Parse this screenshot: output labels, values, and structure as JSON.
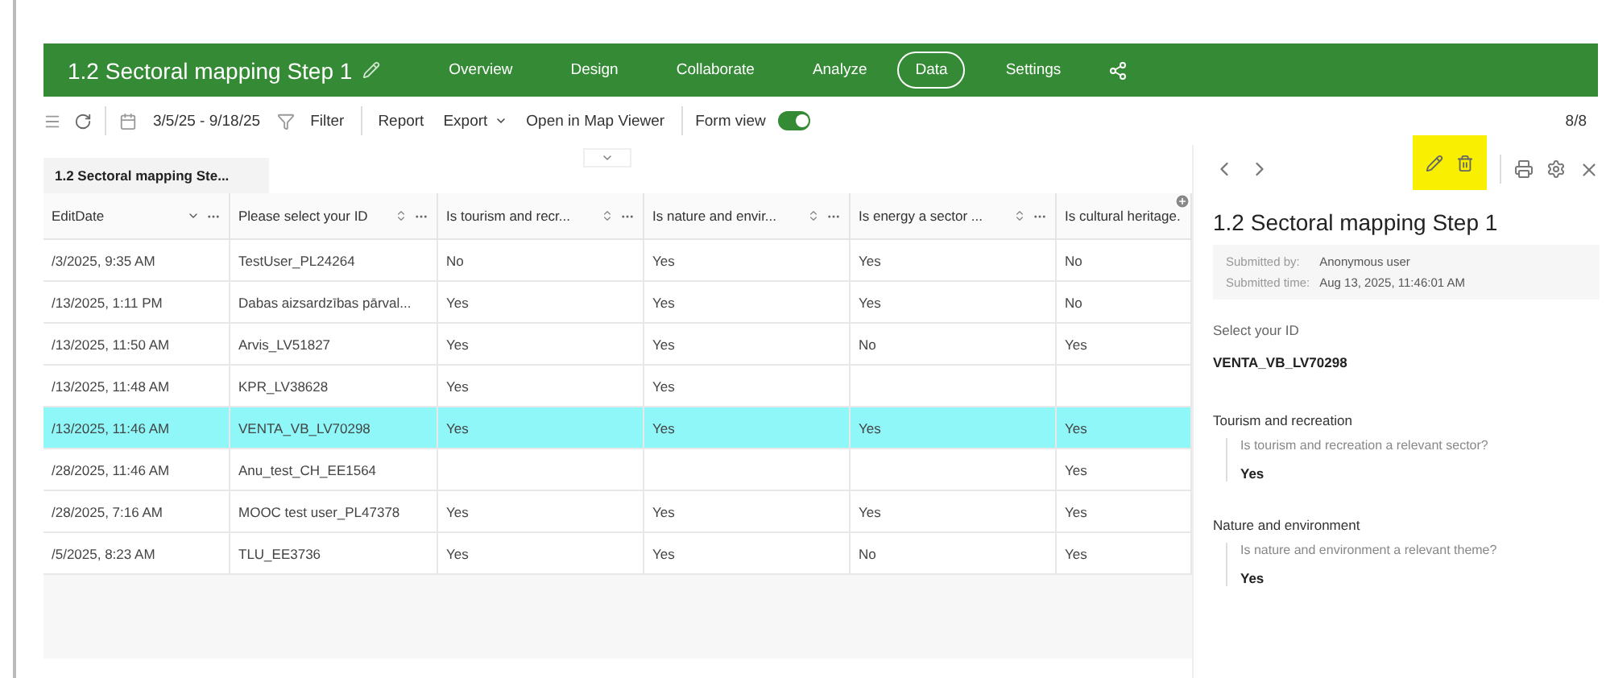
{
  "header": {
    "title": "1.2 Sectoral mapping Step 1",
    "nav": [
      {
        "label": "Overview",
        "selected": false
      },
      {
        "label": "Design",
        "selected": false
      },
      {
        "label": "Collaborate",
        "selected": false
      },
      {
        "label": "Analyze",
        "selected": false
      },
      {
        "label": "Data",
        "selected": true
      },
      {
        "label": "Settings",
        "selected": false
      }
    ]
  },
  "toolbar": {
    "date_range": "3/5/25 - 9/18/25",
    "filter": "Filter",
    "report": "Report",
    "export": "Export",
    "open_map": "Open in Map Viewer",
    "form_view": {
      "label": "Form view",
      "on": true
    },
    "count": "8/8"
  },
  "layer_tab": "1.2 Sectoral mapping Ste...",
  "table": {
    "columns": [
      "EditDate",
      "Please select your ID",
      "Is tourism and recr...",
      "Is nature and envir...",
      "Is energy a sector ...",
      "Is cultural heritage."
    ],
    "rows": [
      {
        "cells": [
          "/3/2025, 9:35 AM",
          "TestUser_PL24264",
          "No",
          "Yes",
          "Yes",
          "No"
        ],
        "selected": false
      },
      {
        "cells": [
          "/13/2025, 1:11 PM",
          "Dabas aizsardzības pārval...",
          "Yes",
          "Yes",
          "Yes",
          "No"
        ],
        "selected": false
      },
      {
        "cells": [
          "/13/2025, 11:50 AM",
          "Arvis_LV51827",
          "Yes",
          "Yes",
          "No",
          "Yes"
        ],
        "selected": false
      },
      {
        "cells": [
          "/13/2025, 11:48 AM",
          "KPR_LV38628",
          "Yes",
          "Yes",
          "",
          ""
        ],
        "selected": false
      },
      {
        "cells": [
          "/13/2025, 11:46 AM",
          "VENTA_VB_LV70298",
          "Yes",
          "Yes",
          "Yes",
          "Yes"
        ],
        "selected": true
      },
      {
        "cells": [
          "/28/2025, 11:46 AM",
          "Anu_test_CH_EE1564",
          "",
          "",
          "",
          "Yes"
        ],
        "selected": false
      },
      {
        "cells": [
          "/28/2025, 7:16 AM",
          "MOOC test user_PL47378",
          "Yes",
          "Yes",
          "Yes",
          "Yes"
        ],
        "selected": false
      },
      {
        "cells": [
          "/5/2025, 8:23 AM",
          "TLU_EE3736",
          "Yes",
          "Yes",
          "No",
          "Yes"
        ],
        "selected": false
      }
    ]
  },
  "panel": {
    "title": "1.2 Sectoral mapping Step 1",
    "meta": [
      {
        "label": "Submitted by:",
        "value": "Anonymous user"
      },
      {
        "label": "Submitted time:",
        "value": "Aug 13, 2025, 11:46:01 AM"
      }
    ],
    "id_label": "Select your ID",
    "id_value": "VENTA_VB_LV70298",
    "sections": [
      {
        "title": "Tourism and recreation",
        "question": "Is tourism and recreation a relevant sector?",
        "answer": "Yes"
      },
      {
        "title": "Nature and environment",
        "question": "Is nature and environment a relevant theme?",
        "answer": "Yes"
      }
    ]
  }
}
